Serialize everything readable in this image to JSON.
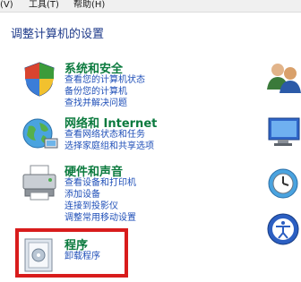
{
  "menubar": {
    "items": [
      "(V)",
      "工具(T)",
      "帮助(H)"
    ]
  },
  "page": {
    "title": "调整计算机的设置"
  },
  "categories": [
    {
      "icon": "shield-icon",
      "title": "系统和安全",
      "links": [
        "查看您的计算机状态",
        "备份您的计算机",
        "查找并解决问题"
      ]
    },
    {
      "icon": "network-globe-icon",
      "title": "网络和 Internet",
      "links": [
        "查看网络状态和任务",
        "选择家庭组和共享选项"
      ]
    },
    {
      "icon": "printer-icon",
      "title": "硬件和声音",
      "links": [
        "查看设备和打印机",
        "添加设备",
        "连接到投影仪",
        "调整常用移动设置"
      ]
    },
    {
      "icon": "programs-icon",
      "title": "程序",
      "links": [
        "卸载程序"
      ]
    }
  ],
  "right_column_icons": [
    "user-accounts-icon",
    "appearance-icon",
    "clock-globe-icon",
    "ease-of-access-icon"
  ],
  "highlight": {
    "color": "#d81c1c",
    "target": "programs"
  }
}
